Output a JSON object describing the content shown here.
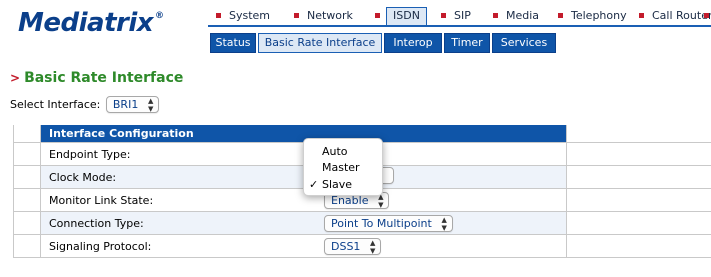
{
  "brand": {
    "name": "Mediatrix",
    "reg": "®"
  },
  "top_nav": [
    {
      "label": "System"
    },
    {
      "label": "Network"
    },
    {
      "label": "ISDN",
      "active": true
    },
    {
      "label": "SIP"
    },
    {
      "label": "Media"
    },
    {
      "label": "Telephony"
    },
    {
      "label": "Call Router"
    }
  ],
  "sub_nav": [
    {
      "label": "Status"
    },
    {
      "label": "Basic Rate Interface",
      "active": true
    },
    {
      "label": "Interop"
    },
    {
      "label": "Timer"
    },
    {
      "label": "Services"
    }
  ],
  "page_title": "Basic Rate Interface",
  "select_interface": {
    "label": "Select Interface:",
    "value": "BRI1"
  },
  "table": {
    "header": "Interface Configuration",
    "rows": [
      {
        "label": "Endpoint Type:",
        "value": ""
      },
      {
        "label": "Clock Mode:",
        "value": "Slave"
      },
      {
        "label": "Monitor Link State:",
        "value": "Enable"
      },
      {
        "label": "Connection Type:",
        "value": "Point To Multipoint"
      },
      {
        "label": "Signaling Protocol:",
        "value": "DSS1"
      }
    ]
  },
  "clock_menu": {
    "options": [
      "Auto",
      "Master",
      "Slave"
    ],
    "selected": "Slave",
    "check": "✓"
  },
  "colors": {
    "brand_blue": "#0b3f8a",
    "nav_blue": "#0f55a8",
    "bullet_red": "#c31b2b",
    "title_green": "#2e8a2a"
  }
}
